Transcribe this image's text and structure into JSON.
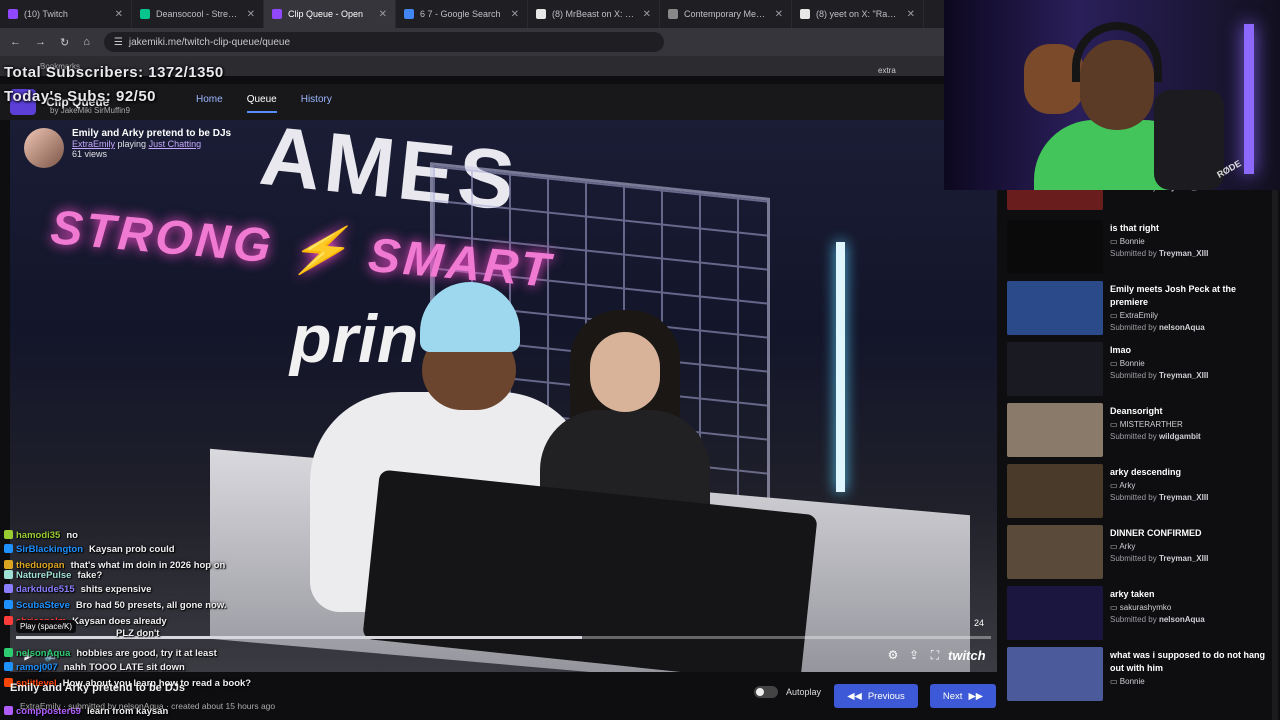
{
  "browser": {
    "tabs": [
      {
        "label": "(10) Twitch",
        "color": "#9146ff"
      },
      {
        "label": "Deansocool - Streamer",
        "color": "#00c48c"
      },
      {
        "label": "Clip Queue - Open",
        "color": "#9146ff",
        "active": true
      },
      {
        "label": "6 7 - Google Search",
        "color": "#4285f4"
      },
      {
        "label": "(8) MrBeast on X: \"Dear",
        "color": "#e7e7e7"
      },
      {
        "label": "Contemporary Menswe",
        "color": "#888888"
      },
      {
        "label": "(8) yeet on X: \"Razer int",
        "color": "#e7e7e7"
      }
    ],
    "url": "jakemiki.me/twitch-clip-queue/queue",
    "bookmarks_label": "Bookmarks",
    "extra_label": "extra"
  },
  "stream_overlay": {
    "total_subs": "Total Subscribers: 1372/1350",
    "today_subs": "Today's Subs: 92/50"
  },
  "app": {
    "title": "Clip Queue",
    "by": "by",
    "author1": "JakeMiki",
    "author2": "SirMuffin9",
    "nav": {
      "home": "Home",
      "queue": "Queue",
      "history": "History"
    }
  },
  "player": {
    "clip_title": "Emily and Arky pretend to be DJs",
    "channel": "ExtraEmily",
    "playing_prefix": "playing",
    "category": "Just Chatting",
    "views": "61 views",
    "progress": 0.58,
    "time_label": "24",
    "tooltip": "Play (space/K)",
    "twitch_label": "twitch"
  },
  "chat": [
    {
      "user": "hamodi35",
      "msg": "no",
      "color": "#9acd32"
    },
    {
      "user": "SirBlackington",
      "msg": "Kaysan prob could",
      "color": "#1e90ff"
    },
    {
      "user": "theduopan",
      "msg": "that's what im doin in 2026 hop on",
      "color": "#daa520"
    },
    {
      "user": "NaturePulse",
      "msg": "fake?",
      "color": "#9fe0d5"
    },
    {
      "user": "darkdude515",
      "msg": "shits expensive",
      "color": "#8a7dff"
    },
    {
      "user": "ScubaSteve",
      "msg": "Bro had 50 presets, all gone now.",
      "color": "#1e90ff"
    },
    {
      "user": "chrisspalm",
      "msg": "Kaysan does already",
      "color": "#ff3b3b"
    },
    {
      "user": "",
      "msg": "PLZ don't",
      "color": "#ffffff"
    },
    {
      "user": "nelsonAqua",
      "msg": "hobbies are good, try it at least",
      "color": "#2ecc71"
    },
    {
      "user": "ramoj007",
      "msg": "nahh TOOO LATE sit down",
      "color": "#1e90ff"
    },
    {
      "user": "splitlevel",
      "msg": "How about you learn how to read a book?",
      "color": "#ff4500"
    },
    {
      "user": "compposter69",
      "msg": "learn from kaysan",
      "color": "#b05cff"
    }
  ],
  "below_player": {
    "title": "Emily and Arky pretend to be DJs",
    "meta": "ExtraEmily · submitted by nelsonAqua · created about 15 hours ago"
  },
  "controls": {
    "autoplay": "Autoplay",
    "previous": "Previous",
    "next": "Next"
  },
  "queue": [
    {
      "title": "",
      "channel": "",
      "submitted": "Treyman_XIII",
      "thumb": "#6a1d1d"
    },
    {
      "title": "is that right",
      "channel": "Bonnie",
      "submitted": "Treyman_XIII",
      "thumb": "#0a0a0a"
    },
    {
      "title": "Emily meets Josh Peck at the premiere",
      "channel": "ExtraEmily",
      "submitted": "nelsonAqua",
      "thumb": "#2a4a8a"
    },
    {
      "title": "lmao",
      "channel": "Bonnie",
      "submitted": "Treyman_XIII",
      "thumb": "#1a1a22"
    },
    {
      "title": "Deansoright",
      "channel": "MISTERARTHER",
      "submitted": "wildgambit",
      "thumb": "#8a7a6a"
    },
    {
      "title": "arky descending",
      "channel": "Arky",
      "submitted": "Treyman_XIII",
      "thumb": "#4a3a2a"
    },
    {
      "title": "DINNER CONFIRMED",
      "channel": "Arky",
      "submitted": "Treyman_XIII",
      "thumb": "#5a4a3a"
    },
    {
      "title": "arky taken",
      "channel": "sakurashymko",
      "submitted": "nelsonAqua",
      "thumb": "#1a1640"
    },
    {
      "title": "what was i supposed to do not hang out with him",
      "channel": "Bonnie",
      "submitted": "",
      "thumb": "#4a5a9a"
    }
  ],
  "submitted_prefix": "Submitted by",
  "webcam": {
    "brand": "RØDE"
  }
}
